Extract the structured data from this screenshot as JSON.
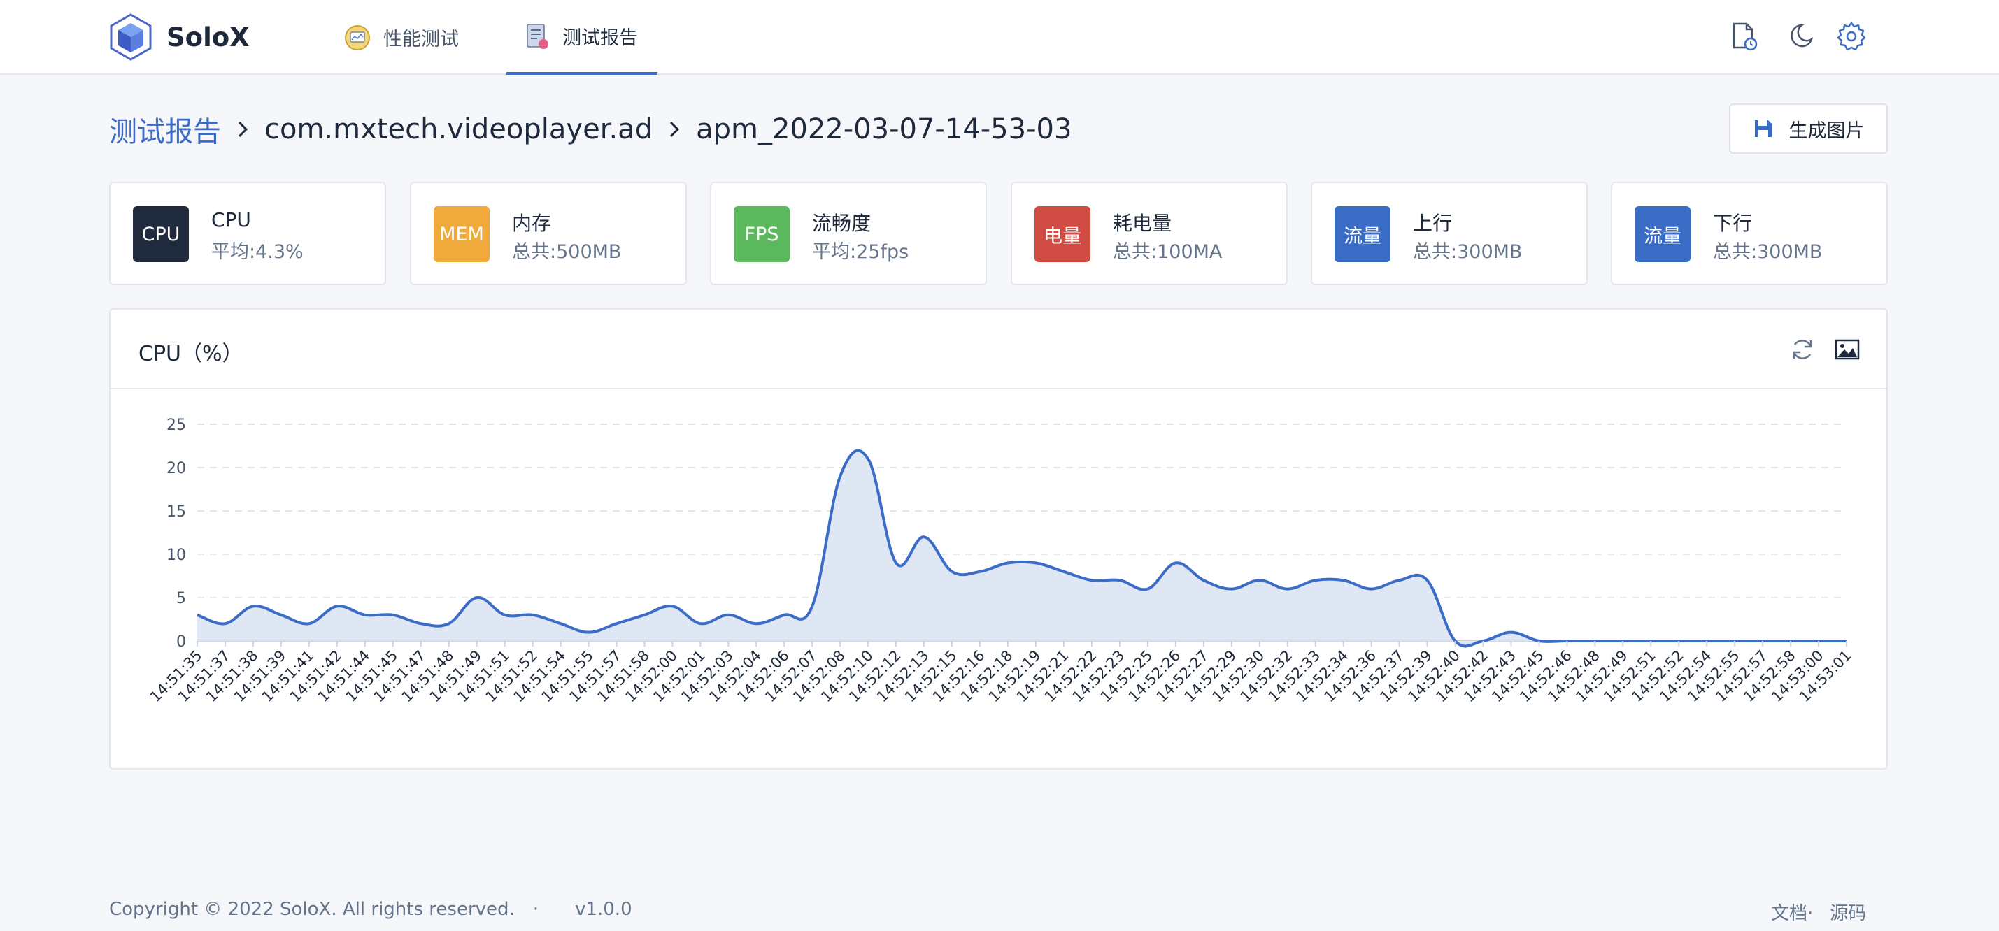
{
  "brand": {
    "name": "SoloX"
  },
  "nav": {
    "tabs": [
      {
        "label": "性能测试",
        "active": false
      },
      {
        "label": "测试报告",
        "active": true
      }
    ],
    "right_icons": [
      "file-clock-icon",
      "moon-icon",
      "gear-icon"
    ]
  },
  "breadcrumb": {
    "root": "测试报告",
    "package": "com.mxtech.videoplayer.ad",
    "report": "apm_2022-03-07-14-53-03"
  },
  "generate_button": {
    "label": "生成图片"
  },
  "cards": [
    {
      "badge": "CPU",
      "title": "CPU",
      "sub": "平均:4.3%",
      "color": "#1f2a3c"
    },
    {
      "badge": "MEM",
      "title": "内存",
      "sub": "总共:500MB",
      "color": "#f0a93b"
    },
    {
      "badge": "FPS",
      "title": "流畅度",
      "sub": "平均:25fps",
      "color": "#5cb85c"
    },
    {
      "badge": "电量",
      "title": "耗电量",
      "sub": "总共:100MA",
      "color": "#cf4b43"
    },
    {
      "badge": "流量",
      "title": "上行",
      "sub": "总共:300MB",
      "color": "#3a6cc5"
    },
    {
      "badge": "流量",
      "title": "下行",
      "sub": "总共:300MB",
      "color": "#3a6cc5"
    }
  ],
  "chart_panel": {
    "title": "CPU（%）",
    "icons": [
      "refresh-icon",
      "image-icon"
    ]
  },
  "chart_data": {
    "type": "area",
    "title": "CPU（%）",
    "xlabel": "",
    "ylabel": "",
    "ylim": [
      0,
      25
    ],
    "yticks": [
      0,
      5,
      10,
      15,
      20,
      25
    ],
    "grid": true,
    "line_color": "#3b6cc7",
    "fill_color": "#dfe6f4",
    "x": [
      "14:51:35",
      "14:51:37",
      "14:51:38",
      "14:51:39",
      "14:51:41",
      "14:51:42",
      "14:51:44",
      "14:51:45",
      "14:51:47",
      "14:51:48",
      "14:51:49",
      "14:51:51",
      "14:51:52",
      "14:51:54",
      "14:51:55",
      "14:51:57",
      "14:51:58",
      "14:52:00",
      "14:52:01",
      "14:52:03",
      "14:52:04",
      "14:52:06",
      "14:52:07",
      "14:52:08",
      "14:52:10",
      "14:52:12",
      "14:52:13",
      "14:52:15",
      "14:52:16",
      "14:52:18",
      "14:52:19",
      "14:52:21",
      "14:52:22",
      "14:52:23",
      "14:52:25",
      "14:52:26",
      "14:52:27",
      "14:52:29",
      "14:52:30",
      "14:52:32",
      "14:52:33",
      "14:52:34",
      "14:52:36",
      "14:52:37",
      "14:52:39",
      "14:52:40",
      "14:52:42",
      "14:52:43",
      "14:52:45",
      "14:52:46",
      "14:52:48",
      "14:52:49",
      "14:52:51",
      "14:52:52",
      "14:52:54",
      "14:52:55",
      "14:52:57",
      "14:52:58",
      "14:53:00",
      "14:53:01"
    ],
    "series": [
      {
        "values": [
          3,
          2,
          4,
          3,
          2,
          4,
          3,
          3,
          2,
          2,
          5,
          3,
          3,
          2,
          1,
          2,
          3,
          4,
          2,
          3,
          2,
          3,
          4,
          19,
          21,
          9,
          12,
          8,
          8,
          9,
          9,
          8,
          7,
          7,
          6,
          9,
          7,
          6,
          7,
          6,
          7,
          7,
          6,
          7,
          7,
          0,
          0,
          1,
          0,
          0,
          0,
          0,
          0,
          0,
          0,
          0,
          0,
          0,
          0,
          0
        ]
      }
    ]
  },
  "footer": {
    "copyright": "Copyright © 2022 SoloX. All rights reserved.",
    "separator": "·",
    "version": "v1.0.0",
    "docs": "文档",
    "source": "源码"
  }
}
